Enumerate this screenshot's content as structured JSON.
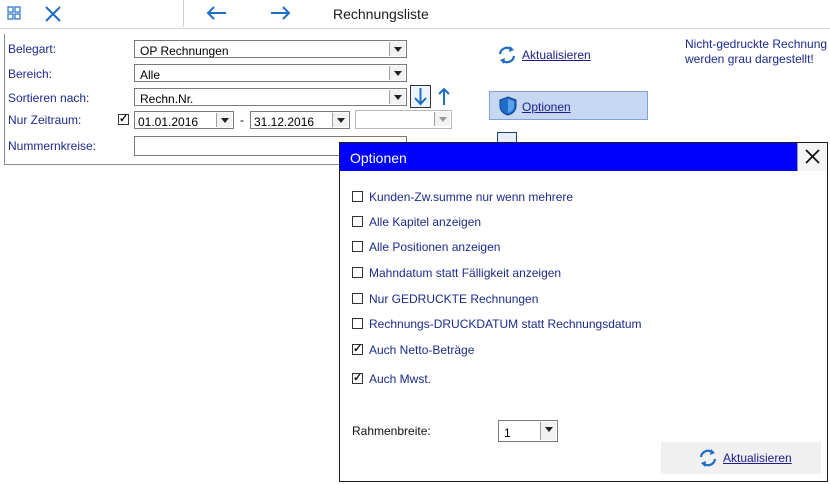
{
  "window": {
    "title": "Rechnungsliste"
  },
  "toolbar": {
    "grid_icon": "grid-icon",
    "close_icon": "close-icon",
    "back_icon": "arrow-left-icon",
    "forward_icon": "arrow-right-icon"
  },
  "form": {
    "belegart": {
      "label": "Belegart:",
      "value": "OP Rechnungen"
    },
    "bereich": {
      "label": "Bereich:",
      "value": "Alle"
    },
    "sortieren": {
      "label": "Sortieren nach:",
      "value": "Rechn.Nr."
    },
    "zeitraum": {
      "label": "Nur Zeitraum:",
      "checked": true,
      "from": "01.01.2016",
      "separator": "-",
      "to": "31.12.2016",
      "extra": ""
    },
    "nummernkreise": {
      "label": "Nummernkreise:",
      "value": ""
    }
  },
  "actions": {
    "refresh_label": "Aktualisieren",
    "options_label": "Optionen"
  },
  "hint": {
    "line1": "Nicht-gedruckte Rechnung",
    "line2": "werden grau dargestellt!"
  },
  "dialog": {
    "title": "Optionen",
    "options": [
      {
        "label": "Kunden-Zw.summe nur wenn mehrere",
        "checked": false
      },
      {
        "label": "Alle Kapitel anzeigen",
        "checked": false
      },
      {
        "label": "Alle Positionen anzeigen",
        "checked": false
      },
      {
        "label": "Mahndatum statt Fälligkeit anzeigen",
        "checked": false
      },
      {
        "label": "Nur GEDRUCKTE Rechnungen",
        "checked": false
      },
      {
        "label": "Rechnungs-DRUCKDATUM statt Rechnungsdatum",
        "checked": false
      },
      {
        "label": "Auch Netto-Beträge",
        "checked": true
      },
      {
        "label": "Auch Mwst.",
        "checked": true
      }
    ],
    "rahmenbreite": {
      "label": "Rahmenbreite:",
      "value": "1"
    },
    "refresh_label": "Aktualisieren"
  },
  "colors": {
    "dialog_title_bg": "#0000ff",
    "label_text": "#1c2a8c",
    "options_button_bg": "#c6d7f2",
    "icon_blue": "#1e6ec8"
  }
}
